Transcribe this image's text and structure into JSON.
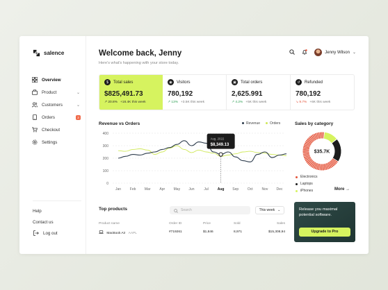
{
  "brand": {
    "name": "salence"
  },
  "sidebar": {
    "items": [
      {
        "label": "Overview",
        "icon": "grid-icon",
        "active": true
      },
      {
        "label": "Product",
        "icon": "bag-icon",
        "chevron": true
      },
      {
        "label": "Customers",
        "icon": "users-icon",
        "chevron": true
      },
      {
        "label": "Orders",
        "icon": "phone-icon",
        "badge": "2"
      },
      {
        "label": "Checkout",
        "icon": "cart-icon"
      },
      {
        "label": "Settings",
        "icon": "gear-icon"
      }
    ],
    "bottom": [
      {
        "label": "Help"
      },
      {
        "label": "Contact us"
      },
      {
        "label": "Log out",
        "icon": "logout-icon"
      }
    ]
  },
  "header": {
    "title": "Welcome back, Jenny",
    "subtitle": "Here's what's happening with your store today.",
    "user_name": "Jenny Wilson"
  },
  "stats": [
    {
      "label": "Total sales",
      "value": "$825,491.73",
      "pct": "20.8%",
      "pct_dir": "up",
      "delta": "+18.4K this week",
      "highlight": true
    },
    {
      "label": "Visitors",
      "value": "780,192",
      "pct": "13%",
      "pct_dir": "up",
      "delta": "+3.5K this week"
    },
    {
      "label": "Total orders",
      "value": "2,625.991",
      "pct": "4.2%",
      "pct_dir": "up",
      "delta": "+5K this week"
    },
    {
      "label": "Refunded",
      "value": "780,192",
      "pct": "9.7%",
      "pct_dir": "down",
      "delta": "+6K this week"
    }
  ],
  "revenue_chart": {
    "title": "Revenue vs Orders",
    "legend": [
      "Revenue",
      "Orders"
    ]
  },
  "chart_data": [
    {
      "type": "line",
      "title": "Revenue vs Orders",
      "x": [
        "Jan",
        "Feb",
        "Mar",
        "Apr",
        "May",
        "Jun",
        "Jul",
        "Aug",
        "Sep",
        "Oct",
        "Nov",
        "Dec"
      ],
      "ylim": [
        0,
        400
      ],
      "yticks": [
        0,
        100,
        200,
        300,
        400
      ],
      "x_positions": [
        0,
        0.5,
        1,
        1.5,
        2,
        2.5,
        3,
        3.5,
        4,
        4.5,
        5,
        5.5,
        6,
        6.5,
        7,
        7.5,
        8,
        8.5,
        9,
        9.5,
        10,
        10.5,
        11,
        11.5
      ],
      "series": [
        {
          "name": "Revenue",
          "color": "#2b3a4a",
          "values": [
            200,
            215,
            230,
            225,
            240,
            250,
            270,
            285,
            310,
            340,
            300,
            330,
            320,
            250,
            230,
            250,
            210,
            180,
            170,
            230,
            250,
            205,
            225,
            235
          ]
        },
        {
          "name": "Orders",
          "color": "#cfe857",
          "values": [
            260,
            255,
            270,
            275,
            265,
            230,
            250,
            280,
            300,
            270,
            245,
            265,
            250,
            240,
            215,
            225,
            235,
            250,
            255,
            245,
            240,
            230,
            225,
            220
          ]
        }
      ],
      "tooltip": {
        "date": "Aug, 2022",
        "value": "$8,349.13",
        "x_index": 7
      },
      "grid": true
    },
    {
      "type": "pie",
      "title": "Sales by category",
      "center_label": "$35.7K",
      "categories": [
        "Electronics",
        "Laptops",
        "iPhones"
      ],
      "values": [
        68,
        20,
        12
      ],
      "colors": [
        "#e4543a",
        "#1c1c1c",
        "#d6f35f"
      ]
    }
  ],
  "sales_category": {
    "title": "Sales by category",
    "center": "$35.7K",
    "items": [
      {
        "label": "Electronics",
        "color": "#e4543a"
      },
      {
        "label": "Laptops",
        "color": "#1c1c1c"
      },
      {
        "label": "iPhones",
        "color": "#d6f35f"
      }
    ],
    "more": "More"
  },
  "products": {
    "title": "Top products",
    "search_placeholder": "Search",
    "period": "This week",
    "columns": [
      "Product name",
      "Order ID",
      "Price",
      "Sold",
      "Sales"
    ],
    "rows": [
      {
        "name": "MacBook Air",
        "ticker": "AAPL",
        "order_id": "#719261",
        "price": "$1,846",
        "sold": "8,971",
        "sales": "$15,308,94"
      }
    ]
  },
  "promo": {
    "text": "Release you maximal potential software.",
    "button": "Upgrade to Pro"
  }
}
